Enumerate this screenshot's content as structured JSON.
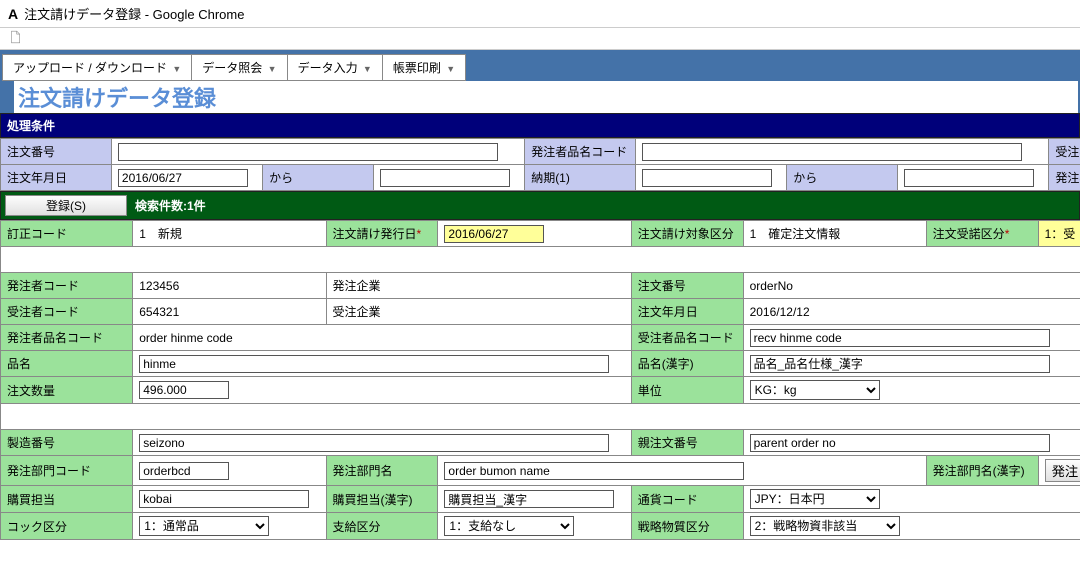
{
  "window": {
    "title": "注文請けデータ登録 - Google Chrome",
    "app_icon": "A"
  },
  "menu": {
    "upload": "アップロード / ダウンロード",
    "inquiry": "データ照会",
    "input": "データ入力",
    "print": "帳票印刷"
  },
  "page_title": "注文請けデータ登録",
  "section": {
    "conditions": "処理条件"
  },
  "cond": {
    "order_no_lbl": "注文番号",
    "order_no_val": "",
    "orderer_item_code_lbl": "発注者品名コード",
    "orderer_item_code_val": "",
    "receiver_item_lbl": "受注者品",
    "order_date_lbl": "注文年月日",
    "order_date_from": "2016/06/27",
    "from_lbl": "から",
    "order_date_to": "",
    "delivery_lbl": "納期(1)",
    "delivery_from": "",
    "delivery_from_lbl": "から",
    "delivery_to": "",
    "orderer_corp_lbl": "発注者コ"
  },
  "results": {
    "register_btn": "登録(S)",
    "count": "検索件数:1件"
  },
  "detail": {
    "correction_lbl": "訂正コード",
    "correction_val": "1　新規",
    "issue_date_lbl": "注文請け発行日",
    "issue_date_val": "2016/06/27",
    "target_lbl": "注文請け対象区分",
    "target_val": "1　確定注文情報",
    "accept_lbl": "注文受諾区分",
    "accept_val": "1：受",
    "orderer_code_lbl": "発注者コード",
    "orderer_code_val": "123456",
    "orderer_corp_lbl2": "発注企業",
    "receiver_code_lbl": "受注者コード",
    "receiver_code_val": "654321",
    "receiver_corp_lbl2": "受注企業",
    "order_no2_lbl": "注文番号",
    "order_no2_val": "orderNo",
    "order_date2_lbl": "注文年月日",
    "order_date2_val": "2016/12/12",
    "orderer_item_lbl2": "発注者品名コード",
    "orderer_item_val2": "order hinme code",
    "receiver_item_lbl2": "受注者品名コード",
    "receiver_item_val2": "recv hinme code",
    "item_name_lbl": "品名",
    "item_name_val": "hinme",
    "item_name_kj_lbl": "品名(漢字)",
    "item_name_kj_val": "品名_品名仕様_漢字",
    "qty_lbl": "注文数量",
    "qty_val": "496.000",
    "unit_lbl": "単位",
    "unit_val": "KG：kg",
    "mfg_no_lbl": "製造番号",
    "mfg_no_val": "seizono",
    "parent_no_lbl": "親注文番号",
    "parent_no_val": "parent order no",
    "order_dept_cd_lbl": "発注部門コード",
    "order_dept_cd_val": "orderbcd",
    "order_dept_nm_lbl": "発注部門名",
    "order_dept_nm_val": "order bumon name",
    "order_dept_kj_lbl": "発注部門名(漢字)",
    "order_dept_kj_btn": "発注",
    "buyer_lbl": "購買担当",
    "buyer_val": "kobai",
    "buyer_kj_lbl": "購買担当(漢字)",
    "buyer_kj_val": "購買担当_漢字",
    "currency_lbl": "通貨コード",
    "currency_val": "JPY：日本円",
    "kog_lbl": "コック区分",
    "kog_val": "1：通常品",
    "supply_lbl": "支給区分",
    "supply_val": "1：支給なし",
    "strat_lbl": "戦略物質区分",
    "strat_val": "2：戦略物資非該当"
  }
}
